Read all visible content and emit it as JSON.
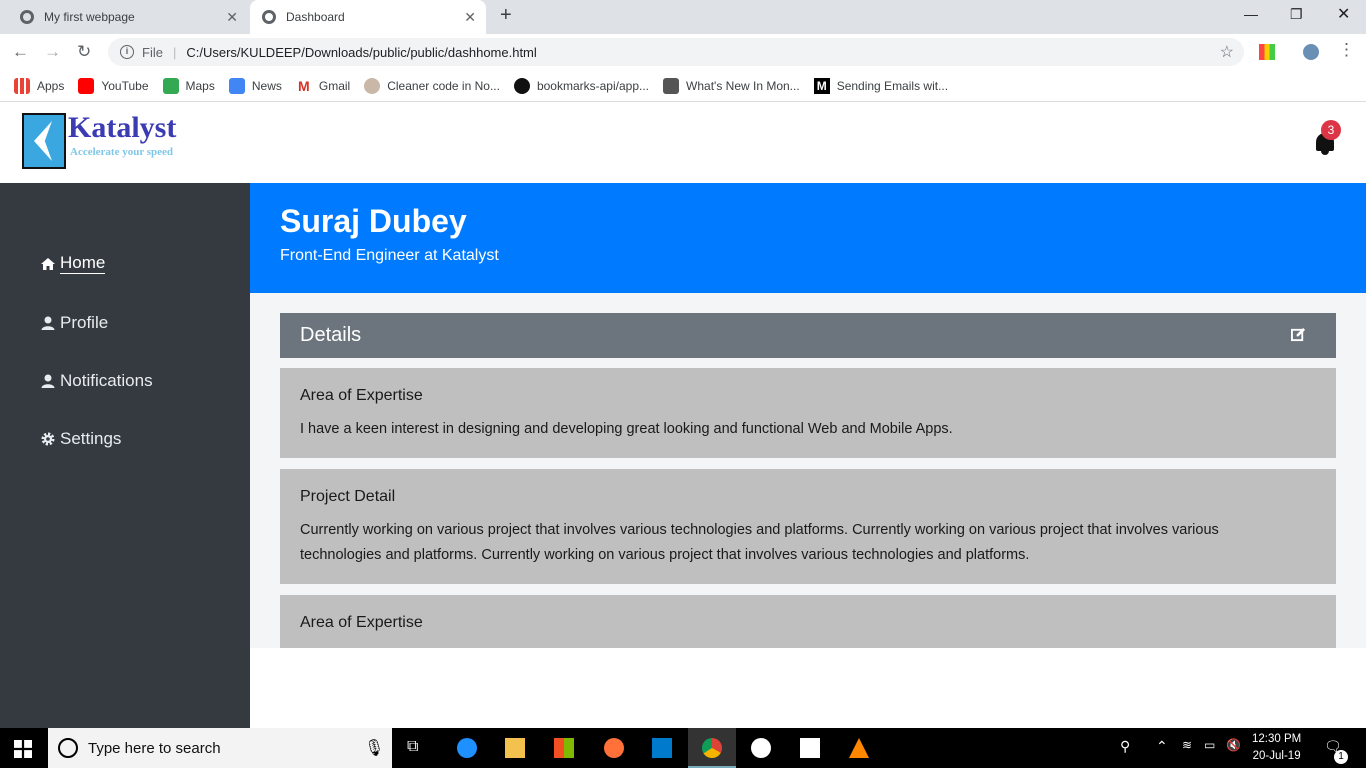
{
  "browser": {
    "tabs": [
      {
        "title": "My first webpage",
        "active": false
      },
      {
        "title": "Dashboard",
        "active": true
      }
    ],
    "address": "C:/Users/KULDEEP/Downloads/public/public/dashhome.html",
    "file_label": "File",
    "bookmarks": [
      {
        "label": "Apps",
        "icon": "apps-grid-icon",
        "color": "#ea4335"
      },
      {
        "label": "YouTube",
        "icon": "youtube-icon",
        "color": "#ff0000"
      },
      {
        "label": "Maps",
        "icon": "maps-icon",
        "color": "#34a853"
      },
      {
        "label": "News",
        "icon": "news-icon",
        "color": "#4285f4"
      },
      {
        "label": "Gmail",
        "icon": "gmail-icon",
        "color": "#d93025"
      },
      {
        "label": "Cleaner code in No...",
        "icon": "cleaner-code-icon",
        "color": "#c9b8a8"
      },
      {
        "label": "bookmarks-api/app...",
        "icon": "github-icon",
        "color": "#111111"
      },
      {
        "label": "What's New In Mon...",
        "icon": "whats-new-icon",
        "color": "#555555"
      },
      {
        "label": "Sending Emails wit...",
        "icon": "medium-icon",
        "color": "#000000"
      }
    ]
  },
  "site": {
    "logo_name": "Katalyst",
    "logo_tagline": "Accelerate your speed",
    "notification_count": "3",
    "accent": "#007bff"
  },
  "sidebar": {
    "items": [
      {
        "label": "Home",
        "icon": "home-icon",
        "active": true
      },
      {
        "label": "Profile",
        "icon": "user-icon",
        "active": false
      },
      {
        "label": "Notifications",
        "icon": "user-icon",
        "active": false
      },
      {
        "label": "Settings",
        "icon": "gear-icon",
        "active": false
      }
    ]
  },
  "hero": {
    "name": "Suraj Dubey",
    "role": "Front-End Engineer at Katalyst"
  },
  "details": {
    "title": "Details",
    "cards": [
      {
        "heading": "Area of Expertise",
        "text": "I have a keen interest in designing and developing great looking and functional Web and Mobile Apps."
      },
      {
        "heading": "Project Detail",
        "text": "Currently working on various project that involves various technologies and platforms. Currently working on various project that involves various technologies and platforms. Currently working on various project that involves various technologies and platforms."
      },
      {
        "heading": "Area of Expertise",
        "text": ""
      }
    ]
  },
  "taskbar": {
    "search_placeholder": "Type here to search",
    "time": "12:30 PM",
    "date": "20-Jul-19",
    "action_center_count": "1"
  }
}
